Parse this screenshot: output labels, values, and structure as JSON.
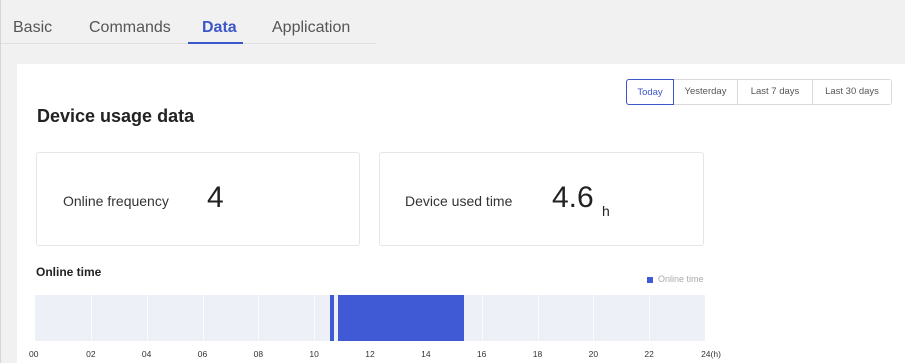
{
  "tabs": [
    {
      "label": "Basic",
      "active": false
    },
    {
      "label": "Commands",
      "active": false
    },
    {
      "label": "Data",
      "active": true
    },
    {
      "label": "Application",
      "active": false
    }
  ],
  "range_selector": {
    "options": [
      "Today",
      "Yesterday",
      "Last 7 days",
      "Last 30 days"
    ],
    "selected": "Today"
  },
  "title": "Device usage data",
  "metrics": {
    "online_frequency": {
      "label": "Online frequency",
      "value": "4"
    },
    "device_used_time": {
      "label": "Device used time",
      "value": "4.6",
      "unit": "h"
    }
  },
  "online_time": {
    "label": "Online time",
    "legend": "Online time",
    "color": "#4059d5",
    "track_color": "#eef0f8"
  },
  "chart_data": {
    "type": "bar",
    "title": "Online time",
    "series": [
      {
        "name": "Online time",
        "segments": [
          [
            10.55,
            10.7
          ],
          [
            10.85,
            15.35
          ]
        ]
      }
    ],
    "xlim": [
      0,
      24
    ],
    "ticks": [
      "00",
      "02",
      "04",
      "06",
      "08",
      "10",
      "12",
      "14",
      "16",
      "18",
      "20",
      "22",
      "24(h)"
    ]
  }
}
